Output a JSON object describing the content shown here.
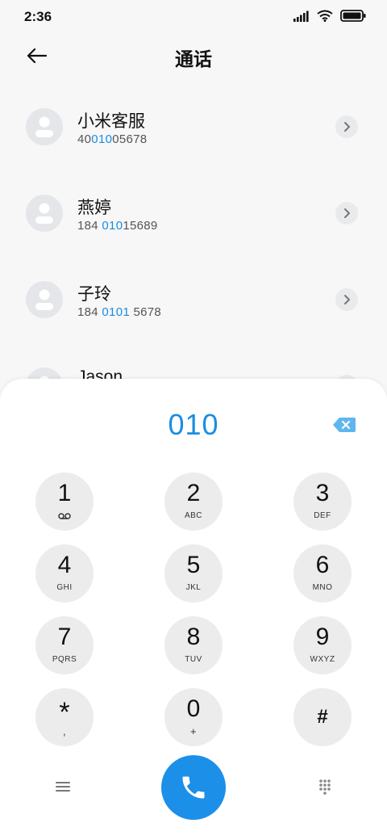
{
  "status_bar": {
    "time": "2:36"
  },
  "header": {
    "title": "通话"
  },
  "contacts": [
    {
      "name": "小米客服",
      "number_parts": [
        "40",
        "010",
        "05678"
      ]
    },
    {
      "name": "燕婷",
      "number_parts": [
        "184 ",
        "010",
        "15689"
      ]
    },
    {
      "name": "子玲",
      "number_parts": [
        "184 ",
        "0101",
        " 5678"
      ]
    },
    {
      "name": "Jason",
      "number_parts": [
        "",
        "",
        ""
      ]
    }
  ],
  "dialpad": {
    "input": "010",
    "keys": [
      {
        "digit": "1",
        "letters": "",
        "sub_icon": "voicemail-icon"
      },
      {
        "digit": "2",
        "letters": "ABC"
      },
      {
        "digit": "3",
        "letters": "DEF"
      },
      {
        "digit": "4",
        "letters": "GHI"
      },
      {
        "digit": "5",
        "letters": "JKL"
      },
      {
        "digit": "6",
        "letters": "MNO"
      },
      {
        "digit": "7",
        "letters": "PQRS"
      },
      {
        "digit": "8",
        "letters": "TUV"
      },
      {
        "digit": "9",
        "letters": "WXYZ"
      },
      {
        "digit": "*",
        "letters": ","
      },
      {
        "digit": "0",
        "letters": "+"
      },
      {
        "digit": "#",
        "letters": ""
      }
    ]
  },
  "colors": {
    "accent": "#1a8ee0",
    "call_button": "#1c8fe9",
    "key_bg": "#ececec"
  }
}
